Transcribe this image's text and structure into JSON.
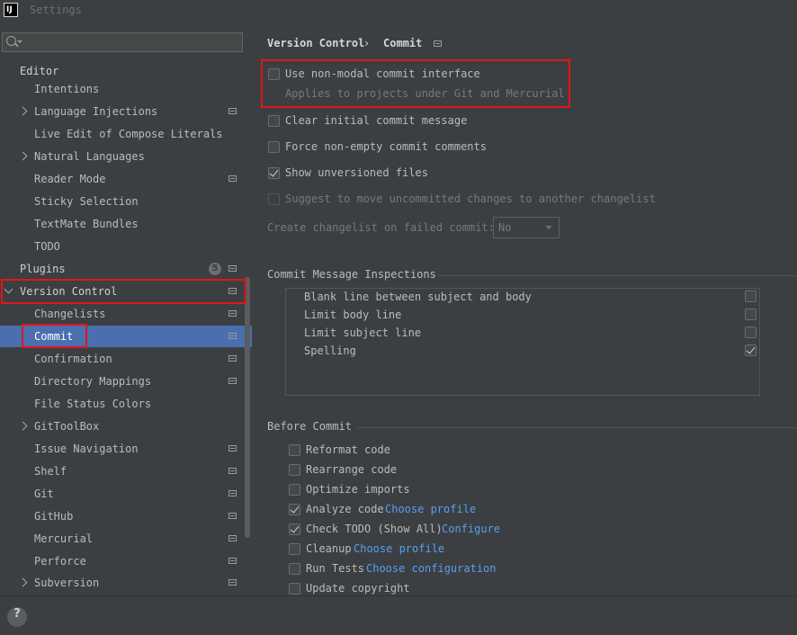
{
  "window": {
    "title": "Settings",
    "app_icon": "IJ"
  },
  "sidebar": {
    "search": {
      "placeholder": ""
    },
    "items": [
      {
        "label": "Editor"
      },
      {
        "label": "Intentions"
      },
      {
        "label": "Language Injections"
      },
      {
        "label": "Live Edit of Compose Literals"
      },
      {
        "label": "Natural Languages"
      },
      {
        "label": "Reader Mode"
      },
      {
        "label": "Sticky Selection"
      },
      {
        "label": "TextMate Bundles"
      },
      {
        "label": "TODO"
      },
      {
        "label": "Plugins",
        "badge": "5"
      },
      {
        "label": "Version Control"
      },
      {
        "label": "Changelists"
      },
      {
        "label": "Commit"
      },
      {
        "label": "Confirmation"
      },
      {
        "label": "Directory Mappings"
      },
      {
        "label": "File Status Colors"
      },
      {
        "label": "GitToolBox"
      },
      {
        "label": "Issue Navigation"
      },
      {
        "label": "Shelf"
      },
      {
        "label": "Git"
      },
      {
        "label": "GitHub"
      },
      {
        "label": "Mercurial"
      },
      {
        "label": "Perforce"
      },
      {
        "label": "Subversion"
      }
    ],
    "selected": "Commit"
  },
  "breadcrumb": {
    "parent": "Version Control",
    "separator": "›",
    "current": "Commit"
  },
  "options": {
    "non_modal": {
      "label": "Use non-modal commit interface",
      "hint": "Applies to projects under Git and Mercurial",
      "checked": false
    },
    "clear_initial": {
      "label": "Clear initial commit message",
      "checked": false
    },
    "force_non_empty": {
      "label": "Force non-empty commit comments",
      "checked": false
    },
    "show_unversioned": {
      "label": "Show unversioned files",
      "checked": true
    },
    "suggest_move": {
      "label": "Suggest to move uncommitted changes to another changelist",
      "checked": false,
      "disabled": true
    },
    "create_changelist": {
      "label": "Create changelist on failed commit:",
      "value": "No"
    }
  },
  "inspections": {
    "title": "Commit Message Inspections",
    "items": [
      {
        "label": "Blank line between subject and body",
        "checked": false
      },
      {
        "label": "Limit body line",
        "checked": false
      },
      {
        "label": "Limit subject line",
        "checked": false
      },
      {
        "label": "Spelling",
        "checked": true
      }
    ]
  },
  "before_commit": {
    "title": "Before Commit",
    "items": [
      {
        "label": "Reformat code",
        "checked": false,
        "link": ""
      },
      {
        "label": "Rearrange code",
        "checked": false,
        "link": ""
      },
      {
        "label": "Optimize imports",
        "checked": false,
        "link": ""
      },
      {
        "label": "Analyze code",
        "checked": true,
        "link": "Choose profile"
      },
      {
        "label": "Check TODO (Show All)",
        "checked": true,
        "link": "Configure"
      },
      {
        "label": "Cleanup",
        "checked": false,
        "link": "Choose profile"
      },
      {
        "label": "Run Tests",
        "checked": false,
        "link": "Choose configuration"
      },
      {
        "label": "Update copyright",
        "checked": false,
        "link": ""
      }
    ]
  },
  "footer": {
    "help": "?"
  },
  "colors": {
    "selection": "#4b6eaf",
    "highlight": "#e0161b",
    "link": "#589df6"
  }
}
